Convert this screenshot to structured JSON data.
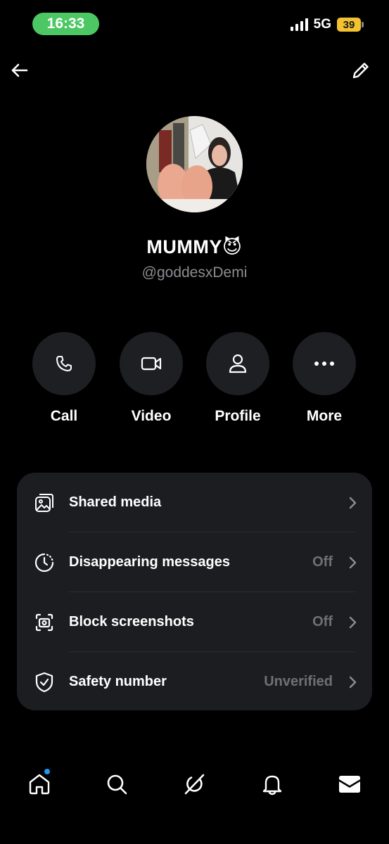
{
  "status_bar": {
    "time": "16:33",
    "network": "5G",
    "battery": "39",
    "colors": {
      "time_pill": "#4cc763",
      "battery": "#f2c230"
    }
  },
  "nav": {
    "back_icon": "arrow-left-icon",
    "edit_icon": "pencil-icon"
  },
  "profile": {
    "display_name": "MUMMY😈",
    "handle": "@goddesxDemi"
  },
  "actions": [
    {
      "label": "Call",
      "icon": "phone-icon"
    },
    {
      "label": "Video",
      "icon": "video-camera-icon"
    },
    {
      "label": "Profile",
      "icon": "person-icon"
    },
    {
      "label": "More",
      "icon": "ellipsis-icon"
    }
  ],
  "settings": [
    {
      "label": "Shared media",
      "value": "",
      "icon": "gallery-icon"
    },
    {
      "label": "Disappearing messages",
      "value": "Off",
      "icon": "timer-icon"
    },
    {
      "label": "Block screenshots",
      "value": "Off",
      "icon": "screenshot-icon"
    },
    {
      "label": "Safety number",
      "value": "Unverified",
      "icon": "shield-check-icon"
    }
  ],
  "tabbar": [
    {
      "name": "home",
      "icon": "home-icon",
      "has_badge": true
    },
    {
      "name": "search",
      "icon": "search-icon"
    },
    {
      "name": "grok",
      "icon": "grok-icon"
    },
    {
      "name": "notifications",
      "icon": "bell-icon"
    },
    {
      "name": "messages",
      "icon": "envelope-icon",
      "active": true
    }
  ],
  "colors": {
    "background": "#000000",
    "card": "#1c1d21",
    "muted_text": "#8b8d91",
    "badge": "#1d9bf0"
  }
}
